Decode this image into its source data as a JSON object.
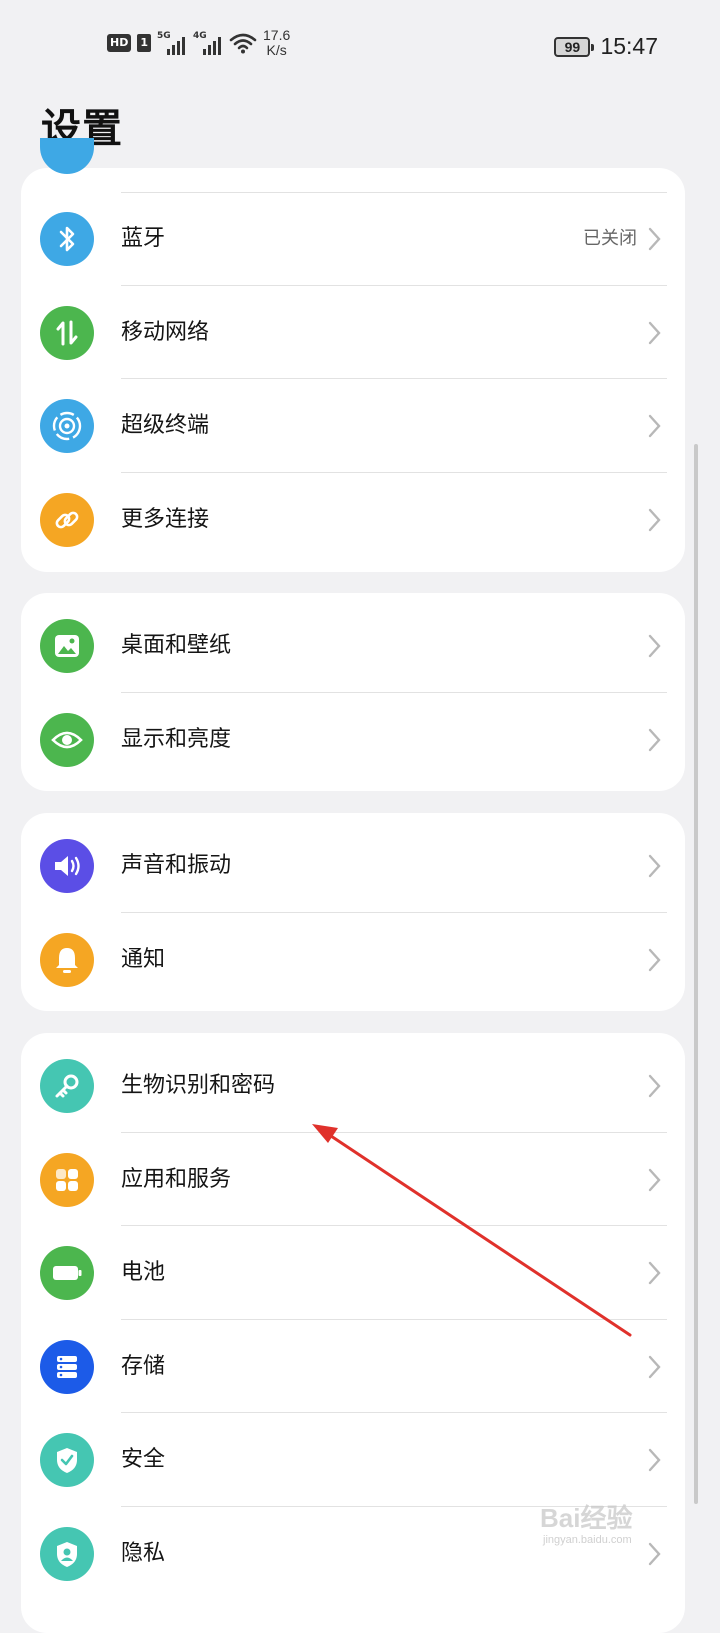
{
  "status_bar": {
    "hd": "HD",
    "sim": "1",
    "network_1": "5G",
    "network_2": "4G",
    "speed_value": "17.6",
    "speed_unit": "K/s",
    "battery": "99",
    "time": "15:47"
  },
  "page_title": "设置",
  "groups": [
    {
      "items": [
        {
          "label": "蓝牙",
          "value": "已关闭",
          "icon": "bluetooth-icon",
          "color": "#3ea8e5"
        },
        {
          "label": "移动网络",
          "icon": "mobile-data-icon",
          "color": "#4cb64e"
        },
        {
          "label": "超级终端",
          "icon": "super-device-icon",
          "color": "#3ea8e5"
        },
        {
          "label": "更多连接",
          "icon": "link-icon",
          "color": "#f5a623"
        }
      ]
    },
    {
      "items": [
        {
          "label": "桌面和壁纸",
          "icon": "wallpaper-icon",
          "color": "#4cb64e"
        },
        {
          "label": "显示和亮度",
          "icon": "eye-icon",
          "color": "#4cb64e"
        }
      ]
    },
    {
      "items": [
        {
          "label": "声音和振动",
          "icon": "speaker-icon",
          "color": "#5b4ee6"
        },
        {
          "label": "通知",
          "icon": "bell-icon",
          "color": "#f5a623"
        }
      ]
    },
    {
      "items": [
        {
          "label": "生物识别和密码",
          "icon": "key-icon",
          "color": "#45c6b2"
        },
        {
          "label": "应用和服务",
          "icon": "apps-icon",
          "color": "#f5a623"
        },
        {
          "label": "电池",
          "icon": "battery-icon",
          "color": "#4cb64e"
        },
        {
          "label": "存储",
          "icon": "storage-icon",
          "color": "#1c5be8"
        },
        {
          "label": "安全",
          "icon": "shield-icon",
          "color": "#45c6b2"
        },
        {
          "label": "隐私",
          "icon": "privacy-icon",
          "color": "#45c6b2"
        }
      ]
    }
  ],
  "watermark": {
    "brand": "Bai经验",
    "url": "jingyan.baidu.com"
  },
  "annotation_color": "#e0312b"
}
